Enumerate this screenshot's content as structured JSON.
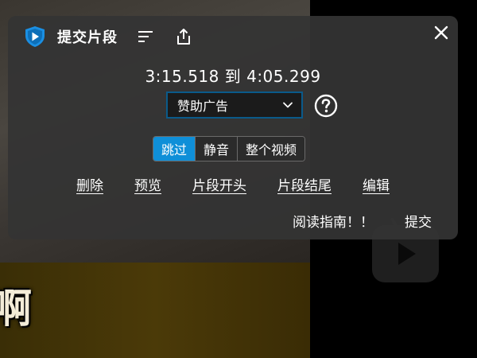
{
  "video": {
    "caption_text": "啊"
  },
  "header": {
    "title": "提交片段",
    "logo_icon": "shield-play-icon",
    "sort_icon": "sort-lines-icon",
    "share_icon": "share-upload-icon",
    "close_icon": "close-icon"
  },
  "segment": {
    "time_range": "3:15.518 到 4:05.299"
  },
  "category": {
    "selected": "赞助广告",
    "help_icon": "question-circle-icon"
  },
  "action_type": {
    "options": [
      "跳过",
      "静音",
      "整个视频"
    ],
    "active_index": 0
  },
  "links": {
    "delete": "删除",
    "preview": "预览",
    "set_start": "片段开头",
    "set_end": "片段结尾",
    "edit": "编辑"
  },
  "footer": {
    "guide": "阅读指南！！",
    "submit": "提交"
  },
  "colors": {
    "accent": "#0f8fd8",
    "panel_bg": "#343434",
    "select_border": "#0a5a8a",
    "logo_blue": "#1a8fe3"
  }
}
